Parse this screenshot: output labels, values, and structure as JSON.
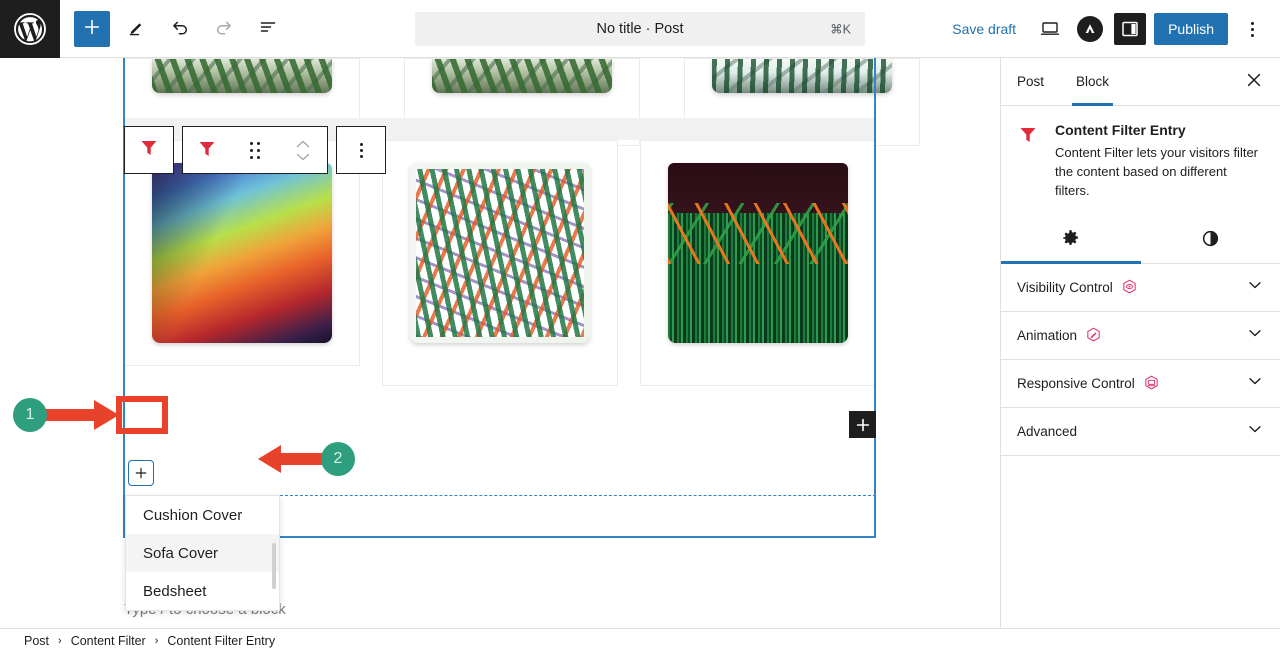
{
  "topbar": {
    "logo_icon": "wordpress-logo-icon",
    "add_block_label": "+",
    "tools": [
      {
        "name": "add-block-button",
        "icon": "plus-icon"
      },
      {
        "name": "edit-tool-button",
        "icon": "pencil-icon"
      },
      {
        "name": "undo-button",
        "icon": "undo-icon"
      },
      {
        "name": "redo-button",
        "icon": "redo-icon"
      },
      {
        "name": "list-view-button",
        "icon": "list-view-icon"
      }
    ],
    "title": "No title · Post",
    "title_shortcut": "⌘K",
    "save_draft_label": "Save draft",
    "preview_icon": "desktop-preview-icon",
    "avatar_icon": "avatar-icon",
    "sidebar_toggle_icon": "sidebar-panel-icon",
    "publish_label": "Publish",
    "options_icon": "kebab-menu-icon"
  },
  "canvas": {
    "block_toolbar": {
      "parent_block_icon": "content-filter-funnel-icon",
      "block_type_icon": "content-filter-funnel-icon",
      "drag_icon": "drag-handle-icon",
      "mover_icon": "move-up-down-icon",
      "more_icon": "kebab-menu-icon"
    },
    "appender_label": "+",
    "dark_plus_label": "+",
    "placeholder": "Type / to choose a block",
    "dropdown": {
      "items": [
        {
          "label": "Cushion Cover",
          "hovered": false
        },
        {
          "label": "Sofa Cover",
          "hovered": true
        },
        {
          "label": "Bedsheet",
          "hovered": false
        }
      ]
    },
    "products": [
      {
        "name": "colorful-tropical-leaf-pillow",
        "art": "p-colorleaf"
      },
      {
        "name": "bird-of-paradise-pillow",
        "art": "p-bird"
      },
      {
        "name": "dark-heliconia-pillow",
        "art": "p-dark"
      }
    ],
    "products_top_row": [
      {
        "name": "jungle-pillow-a",
        "art": "p-jungle-a"
      },
      {
        "name": "jungle-pillow-b",
        "art": "p-jungle-b"
      }
    ]
  },
  "annotations": [
    {
      "number": "1",
      "target": "appender-plus-button"
    },
    {
      "number": "2",
      "target": "cushion-cover-option"
    }
  ],
  "sidebar": {
    "tabs": [
      {
        "label": "Post",
        "active": false
      },
      {
        "label": "Block",
        "active": true
      }
    ],
    "close_icon": "close-icon",
    "block": {
      "icon": "content-filter-funnel-icon",
      "title": "Content Filter Entry",
      "description": "Content Filter lets your visitors filter the content based on different filters."
    },
    "mode_tabs": [
      {
        "name": "settings-tab",
        "icon": "gear-icon",
        "active": true
      },
      {
        "name": "styles-tab",
        "icon": "contrast-icon",
        "active": false
      }
    ],
    "panels": [
      {
        "title": "Visibility Control",
        "badge": "pro-eye-badge-icon",
        "expanded": false
      },
      {
        "title": "Animation",
        "badge": "pro-animation-badge-icon",
        "expanded": false
      },
      {
        "title": "Responsive Control",
        "badge": "pro-responsive-badge-icon",
        "expanded": false
      },
      {
        "title": "Advanced",
        "badge": null,
        "expanded": false
      }
    ]
  },
  "breadcrumb": {
    "items": [
      "Post",
      "Content Filter",
      "Content Filter Entry"
    ],
    "separator": "›"
  },
  "colors": {
    "accent_blue": "#2271b1",
    "selection_blue": "#3582c4",
    "funnel_red": "#e02b3c",
    "annotation_red": "#e8432a",
    "annotation_green": "#2e9e7e",
    "pro_pink": "#e0336b"
  }
}
